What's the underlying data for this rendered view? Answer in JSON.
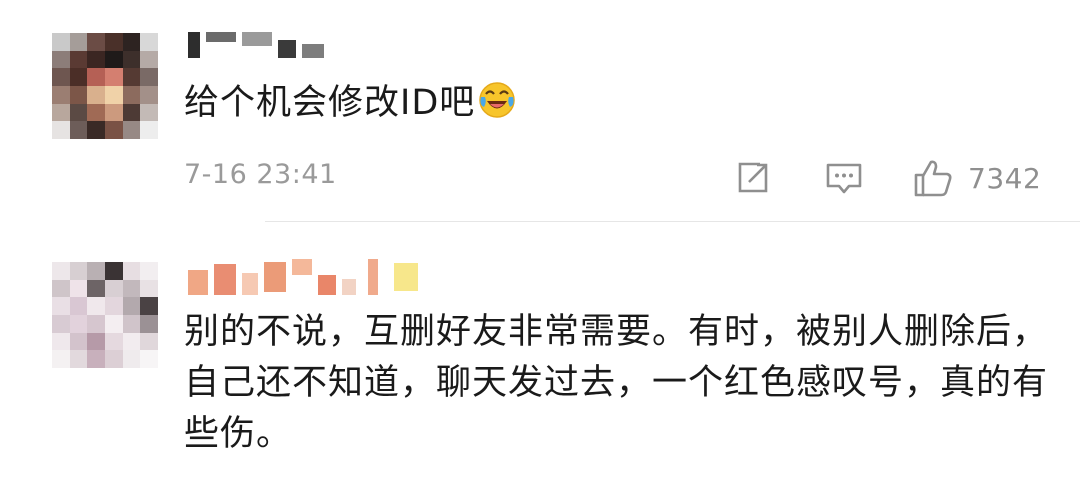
{
  "comments": [
    {
      "text": "给个机会修改ID吧",
      "emoji": "laugh-cry-emoji",
      "timestamp": "7-16 23:41",
      "like_count": "7342"
    },
    {
      "text": "别的不说，互删好友非常需要。有时，被别人删除后，自己还不知道，聊天发过去，一个红色感叹号，真的有些伤。"
    }
  ],
  "icons": {
    "share": "share-icon",
    "reply": "comment-icon",
    "like": "thumbs-up-icon"
  },
  "colors": {
    "text": "#1a1a1a",
    "meta": "#9a9a9a",
    "divider": "#e6e6e6"
  }
}
